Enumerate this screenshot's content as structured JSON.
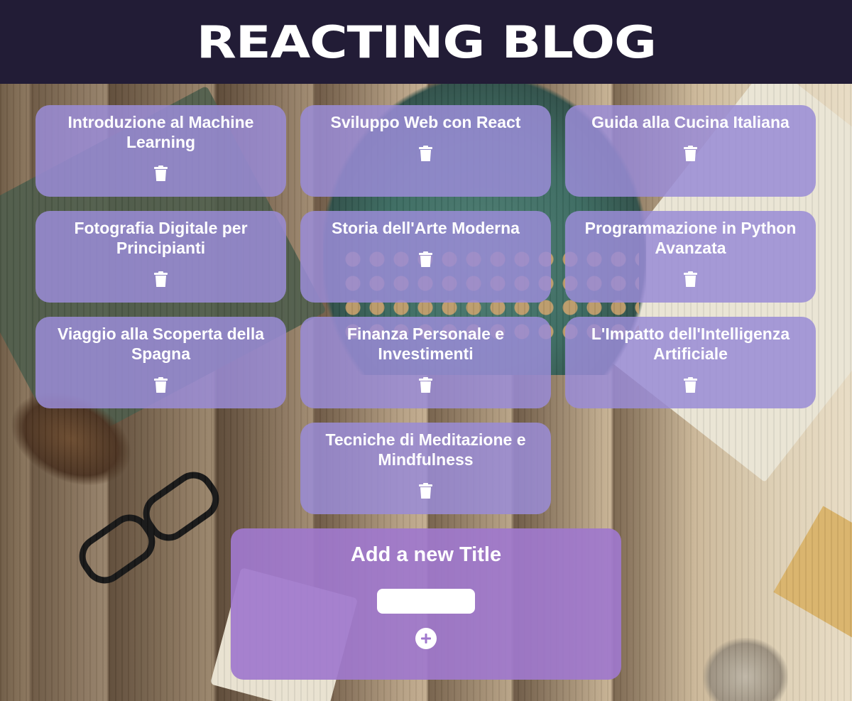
{
  "header": {
    "title": "REACTING BLOG"
  },
  "posts": [
    {
      "title": "Introduzione al Machine Learning",
      "icon": "trash-icon"
    },
    {
      "title": "Sviluppo Web con React",
      "icon": "trash-icon"
    },
    {
      "title": "Guida alla Cucina Italiana",
      "icon": "trash-icon"
    },
    {
      "title": "Fotografia Digitale per Principianti",
      "icon": "trash-icon"
    },
    {
      "title": "Storia dell'Arte Moderna",
      "icon": "trash-icon"
    },
    {
      "title": "Programmazione in Python Avanzata",
      "icon": "trash-icon"
    },
    {
      "title": "Viaggio alla Scoperta della Spagna",
      "icon": "trash-icon"
    },
    {
      "title": "Finanza Personale e Investimenti",
      "icon": "trash-icon"
    },
    {
      "title": "L'Impatto dell'Intelligenza Artificiale",
      "icon": "trash-icon"
    },
    {
      "title": "Tecniche di Meditazione e Mindfulness",
      "icon": "trash-icon"
    }
  ],
  "add_form": {
    "title": "Add a new Title",
    "input_value": "",
    "add_icon": "plus-circle-icon"
  },
  "colors": {
    "header_bg": "#221c36",
    "card_bg": "#9a8cd6",
    "add_panel_bg": "#a078cd",
    "add_icon_color": "#a078cd"
  }
}
